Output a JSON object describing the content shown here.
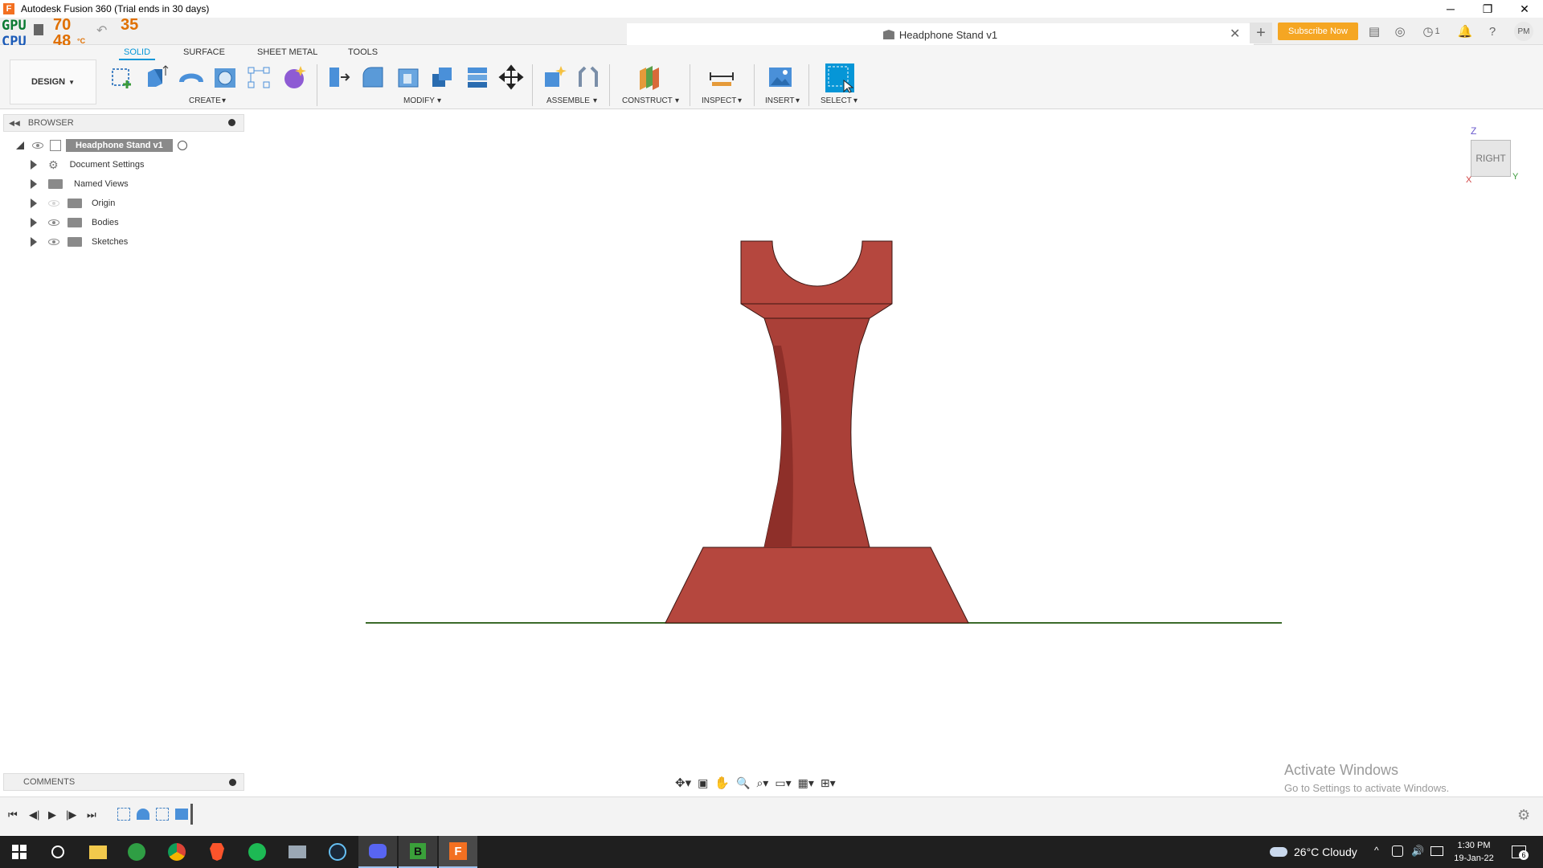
{
  "window": {
    "title": "Autodesk Fusion 360 (Trial ends in 30 days)",
    "app_logo": "F",
    "minimize": "─",
    "restore": "❐",
    "close": "✕"
  },
  "hw_monitor": {
    "gpu_label": "GPU",
    "cpu_label": "CPU",
    "gpu_temp": "70",
    "cpu_temp": "48",
    "other_temp": "35",
    "unit": "°C"
  },
  "document_tab": {
    "title": "Headphone Stand v1",
    "close": "✕",
    "new_tab": "+"
  },
  "header": {
    "subscribe_label": "Subscribe Now",
    "jobs_count": "1",
    "avatar_initials": "PM"
  },
  "ribbon": {
    "workspace": "DESIGN",
    "tabs": [
      "SOLID",
      "SURFACE",
      "SHEET METAL",
      "TOOLS"
    ],
    "active_tab": "SOLID",
    "groups": [
      "CREATE",
      "MODIFY",
      "ASSEMBLE",
      "CONSTRUCT",
      "INSPECT",
      "INSERT",
      "SELECT"
    ]
  },
  "browser": {
    "title": "BROWSER",
    "root": "Headphone Stand v1",
    "items": [
      {
        "label": "Document Settings",
        "icon": "gear-icon"
      },
      {
        "label": "Named Views",
        "icon": "folder-icon"
      },
      {
        "label": "Origin",
        "icon": "folder-icon"
      },
      {
        "label": "Bodies",
        "icon": "folder-icon"
      },
      {
        "label": "Sketches",
        "icon": "folder-icon"
      }
    ]
  },
  "comments": {
    "title": "COMMENTS"
  },
  "viewcube": {
    "face": "RIGHT",
    "z": "Z",
    "y": "Y",
    "x": "X"
  },
  "watermark": {
    "line1": "Activate Windows",
    "line2": "Go to Settings to activate Windows."
  },
  "colors": {
    "model_body": "#b5473e",
    "model_shadow": "#8e2f29",
    "ground_line": "#3b6b2b",
    "accent": "#0696d7",
    "subscribe": "#f5a623"
  },
  "taskbar": {
    "weather": "26°C  Cloudy",
    "time": "1:30 PM",
    "date": "19-Jan-22",
    "notifications": "6"
  }
}
